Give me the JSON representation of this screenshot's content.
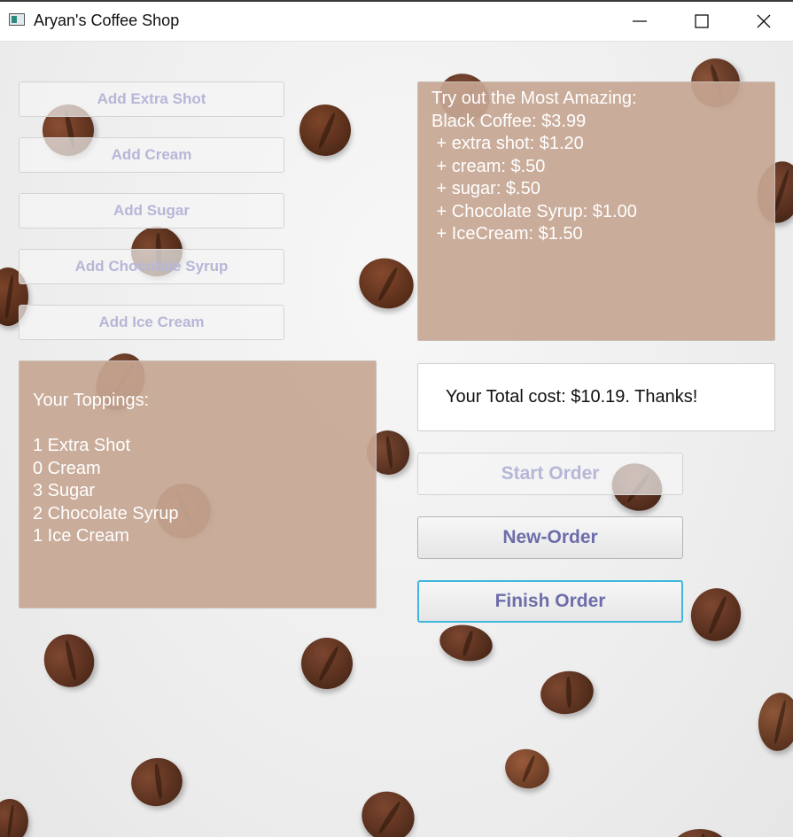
{
  "window": {
    "title": "Aryan's Coffee Shop"
  },
  "toppings_buttons": [
    {
      "label": "Add Extra Shot"
    },
    {
      "label": "Add Cream"
    },
    {
      "label": "Add Sugar"
    },
    {
      "label": "Add Chocolate Syrup"
    },
    {
      "label": "Add Ice Cream"
    }
  ],
  "menu_panel": {
    "lines": [
      "Try out the Most Amazing:",
      "Black Coffee: $3.99",
      " + extra shot: $1.20",
      " + cream: $.50",
      " + sugar: $.50",
      " + Chocolate Syrup: $1.00",
      " + IceCream: $1.50"
    ]
  },
  "toppings_panel": {
    "heading": "Your Toppings:",
    "items": [
      "1 Extra Shot",
      "0 Cream",
      "3 Sugar",
      "2 Chocolate Syrup",
      "1 Ice Cream"
    ]
  },
  "total_text": "Your Total cost: $10.19. Thanks!",
  "order_buttons": {
    "start": "Start Order",
    "new": "New-Order",
    "finish": "Finish Order"
  },
  "colors": {
    "panel": "#c7a692",
    "button_text": "#6d6dab",
    "focus": "#3fb7dc",
    "bean": "#5a2f1c"
  }
}
